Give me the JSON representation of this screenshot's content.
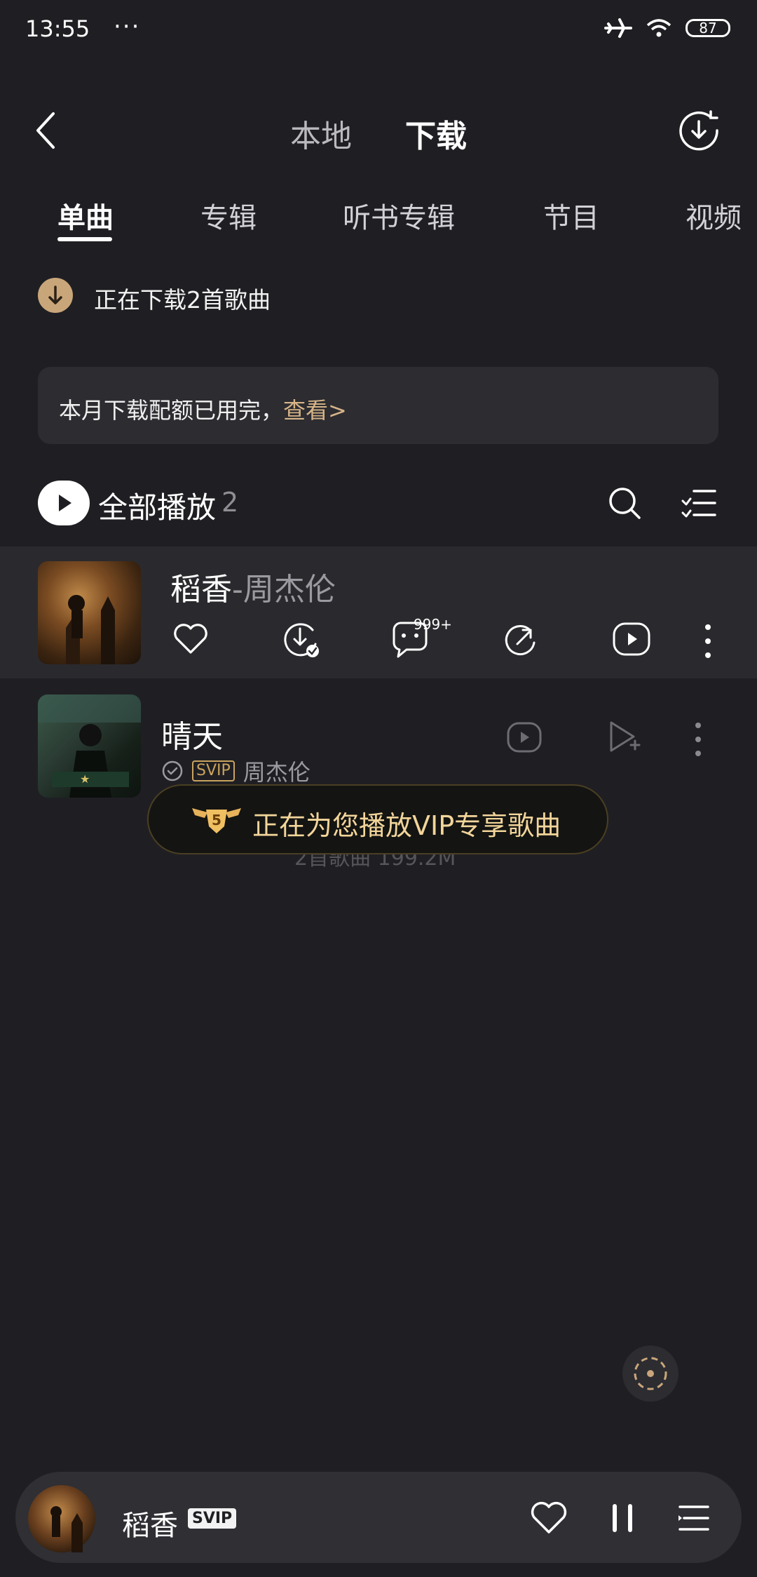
{
  "status_bar": {
    "time": "13:55",
    "more_dots": "···",
    "battery": "87",
    "icons": [
      "airplane-icon",
      "wifi-icon",
      "battery-icon"
    ]
  },
  "header": {
    "back_icon": "chevron-left-icon",
    "tabs": [
      {
        "label": "本地",
        "active": false
      },
      {
        "label": "下载",
        "active": true
      }
    ],
    "download_manager_icon": "download-circle-icon"
  },
  "category_tabs": [
    {
      "label": "单曲",
      "active": true
    },
    {
      "label": "专辑",
      "active": false
    },
    {
      "label": "听书专辑",
      "active": false
    },
    {
      "label": "节目",
      "active": false
    },
    {
      "label": "视频",
      "active": false
    }
  ],
  "downloading": {
    "text": "正在下载2首歌曲",
    "icon": "download-arrow-icon"
  },
  "quota_banner": {
    "text": "本月下载配额已用完，",
    "link": "查看>"
  },
  "toolbar": {
    "play_all_label": "全部播放",
    "count": "2",
    "icons": [
      "play-icon",
      "search-icon",
      "multi-select-icon"
    ]
  },
  "songs": [
    {
      "title": "稻香",
      "artist": "-周杰伦",
      "expanded": true,
      "actions": [
        {
          "icon": "heart-icon"
        },
        {
          "icon": "downloaded-icon"
        },
        {
          "icon": "comment-icon",
          "badge": "999+"
        },
        {
          "icon": "share-icon"
        },
        {
          "icon": "mv-icon"
        },
        {
          "icon": "more-vertical-icon"
        }
      ]
    },
    {
      "title": "晴天",
      "badge": "SVIP",
      "artist": "周杰伦",
      "actions": [
        {
          "icon": "mv-icon"
        },
        {
          "icon": "add-to-playlist-icon"
        },
        {
          "icon": "more-vertical-icon"
        }
      ]
    }
  ],
  "toast": {
    "text": "正在为您播放VIP专享歌曲",
    "icon": "vip-wings-icon",
    "icon_label": "5"
  },
  "footer_count": "2首歌曲 199.2M",
  "floating_button_icon": "locate-icon",
  "mini_player": {
    "title": "稻香",
    "badge": "SVIP",
    "icons": [
      "heart-icon",
      "pause-icon",
      "playlist-icon"
    ]
  },
  "colors": {
    "background": "#1f1f23",
    "gold": "#d6b487",
    "toast_text": "#f2d59a"
  }
}
